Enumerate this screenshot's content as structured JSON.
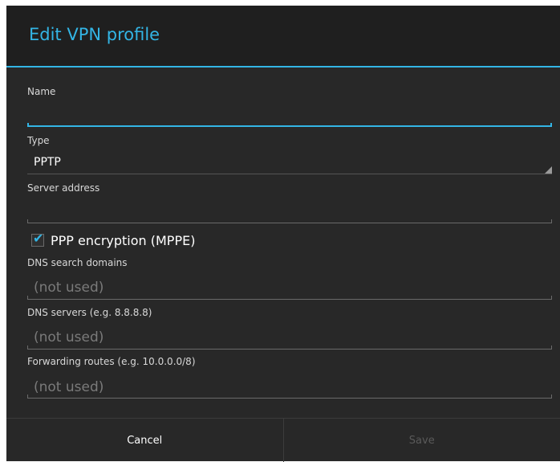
{
  "dialog": {
    "title": "Edit VPN profile",
    "accent_color": "#33b5e5",
    "background_color": "#282828"
  },
  "fields": {
    "name": {
      "label": "Name",
      "value": "",
      "placeholder": ""
    },
    "type": {
      "label": "Type",
      "value": "PPTP"
    },
    "server_address": {
      "label": "Server address",
      "value": "",
      "placeholder": ""
    },
    "ppp_encryption": {
      "label": "PPP encryption (MPPE)",
      "checked": true,
      "check_glyph": "✔"
    },
    "dns_search_domains": {
      "label": "DNS search domains",
      "value": "",
      "placeholder": "(not used)"
    },
    "dns_servers": {
      "label": "DNS servers (e.g. 8.8.8.8)",
      "value": "",
      "placeholder": "(not used)"
    },
    "forwarding_routes": {
      "label": "Forwarding routes (e.g. 10.0.0.0/8)",
      "value": "",
      "placeholder": "(not used)"
    }
  },
  "buttons": {
    "cancel": "Cancel",
    "save": "Save"
  },
  "icons": {
    "spinner_arrow": "dropdown-triangle-icon",
    "checkmark": "checkmark-icon"
  }
}
